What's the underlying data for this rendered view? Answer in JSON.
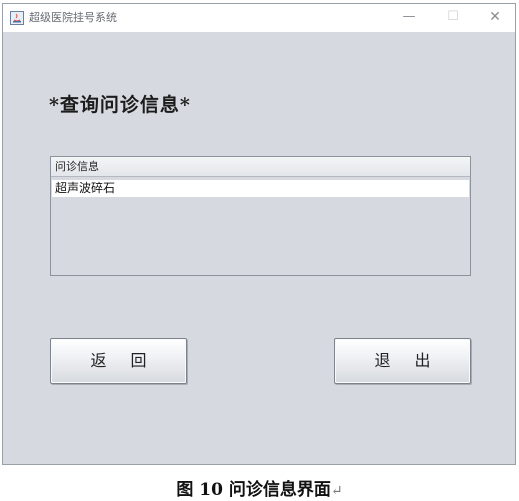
{
  "window": {
    "title": "超级医院挂号系统",
    "min_glyph": "—",
    "max_glyph": "☐",
    "close_glyph": "✕"
  },
  "heading": "*查询问诊信息*",
  "list": {
    "header": "问诊信息",
    "rows": [
      "超声波碎石"
    ]
  },
  "buttons": {
    "back_label": "返回",
    "exit_label": "退出"
  },
  "caption": {
    "text": "图 10  问诊信息界面",
    "mark": "↵"
  },
  "colors": {
    "window_bg": "#d6d9df",
    "row_selected_bg": "#ffffff"
  }
}
